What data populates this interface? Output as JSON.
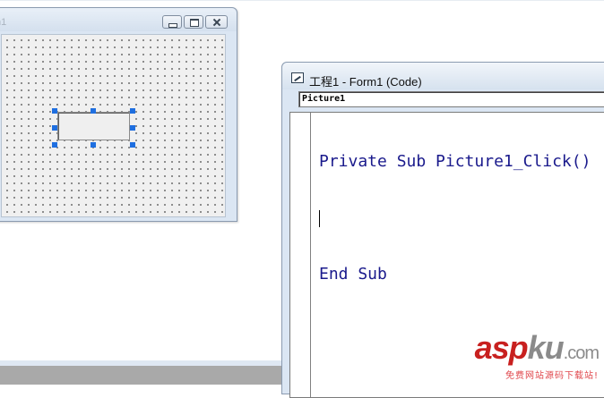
{
  "form_window": {
    "title": "n1",
    "caption_buttons": [
      "minimize",
      "maximize",
      "close"
    ],
    "control": {
      "type": "picture-box",
      "name": "Picture1",
      "selected": true
    }
  },
  "code_window": {
    "title": "工程1 - Form1 (Code)",
    "object_selector": "Picture1",
    "code_lines": [
      "Private Sub Picture1_Click()",
      "",
      "End Sub"
    ]
  },
  "watermark": {
    "logo_a": "asp",
    "logo_b": "ku",
    "logo_c": ".com",
    "subtitle": "免费网站源码下载站!"
  },
  "colors": {
    "keyword": "#1a1a8c",
    "selection_handle": "#1f6fe0",
    "watermark_red": "#c8201f"
  }
}
